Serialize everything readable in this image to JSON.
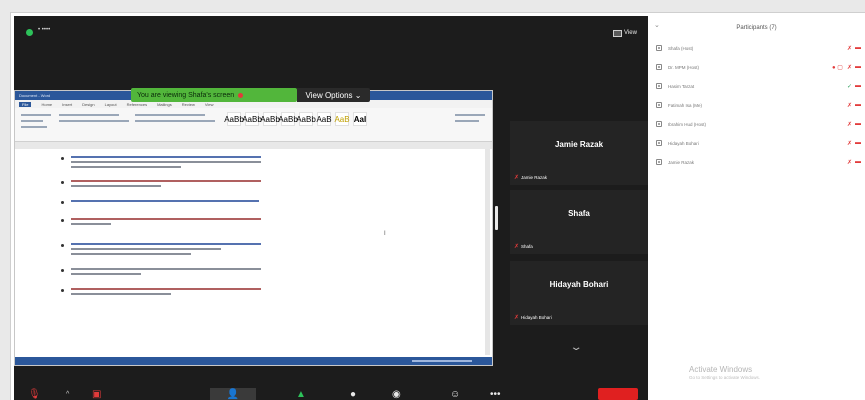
{
  "meeting": {
    "label": "• ••••",
    "view_label": "View"
  },
  "share": {
    "viewing_text": "You are viewing Shafa's screen",
    "view_options_label": "View Options ⌄"
  },
  "word": {
    "title": "Document - Word",
    "tabs": [
      "File",
      "Home",
      "Insert",
      "Design",
      "Layout",
      "References",
      "Mailings",
      "Review",
      "View"
    ],
    "styles": [
      "AaBb",
      "AaBb",
      "AaBb",
      "AaBb",
      "AaBb",
      "AaB",
      "AaB",
      "AaI"
    ]
  },
  "tiles": [
    {
      "name": "Jamie Razak",
      "label": "Jamie Razak"
    },
    {
      "name": "Shafa",
      "label": "Shafa"
    },
    {
      "name": "Hidayah Bohari",
      "label": "Hidayah Bohari"
    }
  ],
  "panel": {
    "title": "Participants (7)",
    "participants": [
      {
        "name": "Shafa (Host)",
        "extra": ""
      },
      {
        "name": "Dr. MPM (Host)",
        "extra": "● ▢"
      },
      {
        "name": "Hasim Tarzat",
        "extra": ""
      },
      {
        "name": "Fatimah Isa (Me)",
        "extra": ""
      },
      {
        "name": "Ibrahim Hud (Host)",
        "extra": ""
      },
      {
        "name": "Hidayah Bohari",
        "extra": ""
      },
      {
        "name": "Jamie Razak",
        "extra": ""
      }
    ]
  },
  "watermark": {
    "line1": "Activate Windows",
    "line2": "Go to Settings to activate Windows."
  },
  "colors": {
    "meeting_bg": "#1c1c1c",
    "share_banner": "#52b63b",
    "end_button": "#e02020",
    "word_blue": "#2b579a"
  },
  "icons": [
    "security-dot-icon",
    "gallery-view-icon",
    "mic-muted-icon",
    "video-off-icon",
    "participants-icon",
    "share-screen-icon",
    "chat-icon",
    "record-icon",
    "reactions-icon",
    "more-icon",
    "chevron-down-icon"
  ]
}
